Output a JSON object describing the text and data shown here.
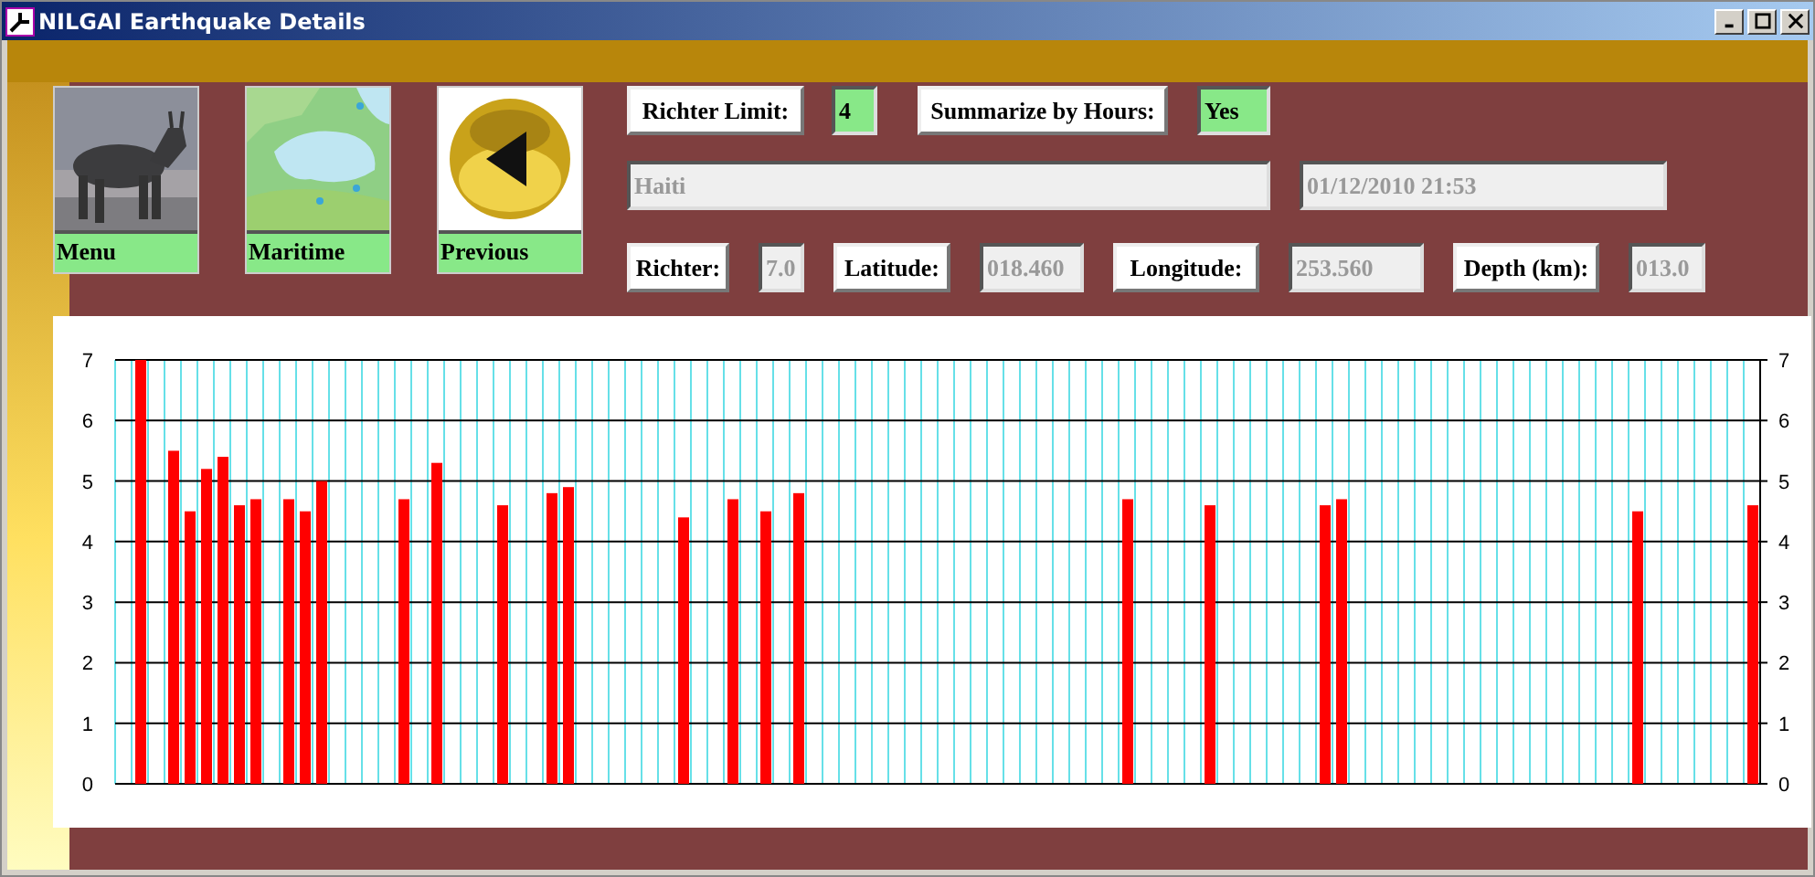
{
  "window": {
    "title": "NILGAI Earthquake Details"
  },
  "nav_buttons": [
    {
      "kind": "animal",
      "label": "Menu"
    },
    {
      "kind": "map",
      "label": "Maritime"
    },
    {
      "kind": "back",
      "label": "Previous"
    }
  ],
  "filters": [
    {
      "label": "Richter Limit:",
      "value": "4",
      "disabled": false
    },
    {
      "label": "Summarize by Hours:",
      "value": "Yes",
      "disabled": false
    }
  ],
  "location": {
    "value": "Haiti",
    "disabled": true
  },
  "datetime": {
    "value": "01/12/2010 21:53",
    "disabled": true
  },
  "details": [
    {
      "label": "Richter:",
      "value": "7.0",
      "disabled": true
    },
    {
      "label": "Latitude:",
      "value": "018.460",
      "disabled": true
    },
    {
      "label": "Longitude:",
      "value": "253.560",
      "disabled": true
    },
    {
      "label": "Depth (km):",
      "value": "013.0",
      "disabled": true
    }
  ],
  "chart": {
    "right_axis_labels": [
      "7",
      "6",
      "5",
      "4",
      "3",
      "2",
      "1",
      "0"
    ],
    "chart_data": {
      "type": "bar",
      "grid": true,
      "ylim": [
        0,
        7
      ],
      "yticks": [
        0,
        1,
        2,
        3,
        4,
        5,
        6,
        7
      ],
      "series": [
        {
          "color": "#ff0000",
          "values": [
            null,
            7.0,
            null,
            5.5,
            4.5,
            5.2,
            5.4,
            4.6,
            4.7,
            null,
            4.7,
            4.5,
            5.0,
            null,
            null,
            null,
            null,
            4.7,
            null,
            5.3,
            null,
            null,
            null,
            4.6,
            null,
            null,
            4.8,
            4.9,
            null,
            null,
            null,
            null,
            null,
            null,
            4.4,
            null,
            null,
            4.7,
            null,
            4.5,
            null,
            4.8,
            null,
            null,
            null,
            null,
            null,
            null,
            null,
            null,
            null,
            null,
            null,
            null,
            null,
            null,
            null,
            null,
            null,
            null,
            null,
            4.7,
            null,
            null,
            null,
            null,
            4.6,
            null,
            null,
            null,
            null,
            null,
            null,
            4.6,
            4.7,
            null,
            null,
            null,
            null,
            null,
            null,
            null,
            null,
            null,
            null,
            null,
            null,
            null,
            null,
            null,
            null,
            null,
            4.5,
            null,
            null,
            null,
            null,
            null,
            null,
            4.6
          ]
        }
      ]
    }
  }
}
